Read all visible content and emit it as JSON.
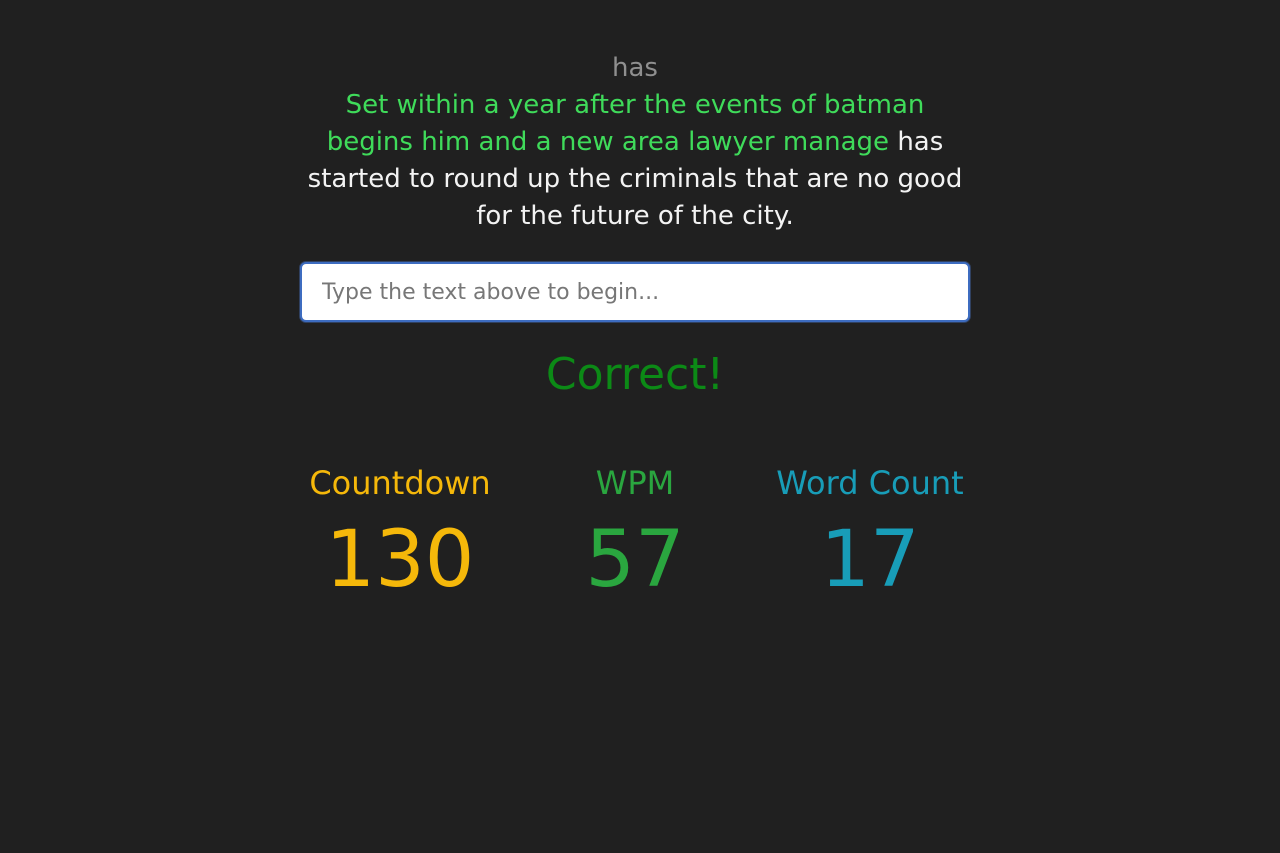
{
  "current_word": "has",
  "passage": {
    "typed": "Set within a year after the events of batman begins him and a new area lawyer manage",
    "remaining": " has started to round up the criminals that are no good for the future of the city."
  },
  "input": {
    "value": "",
    "placeholder": "Type the text above to begin..."
  },
  "status": {
    "text": "Correct!",
    "color": "#0c8a16"
  },
  "stats": {
    "countdown": {
      "label": "Countdown",
      "value": "130",
      "color": "#f5b80a"
    },
    "wpm": {
      "label": "WPM",
      "value": "57",
      "color": "#2aa63f"
    },
    "word_count": {
      "label": "Word Count",
      "value": "17",
      "color": "#189db8"
    }
  },
  "colors": {
    "background": "#202020",
    "typed_text": "#3fdb5a",
    "remaining_text": "#f3f3f3",
    "current_word": "#8f8f8f"
  }
}
